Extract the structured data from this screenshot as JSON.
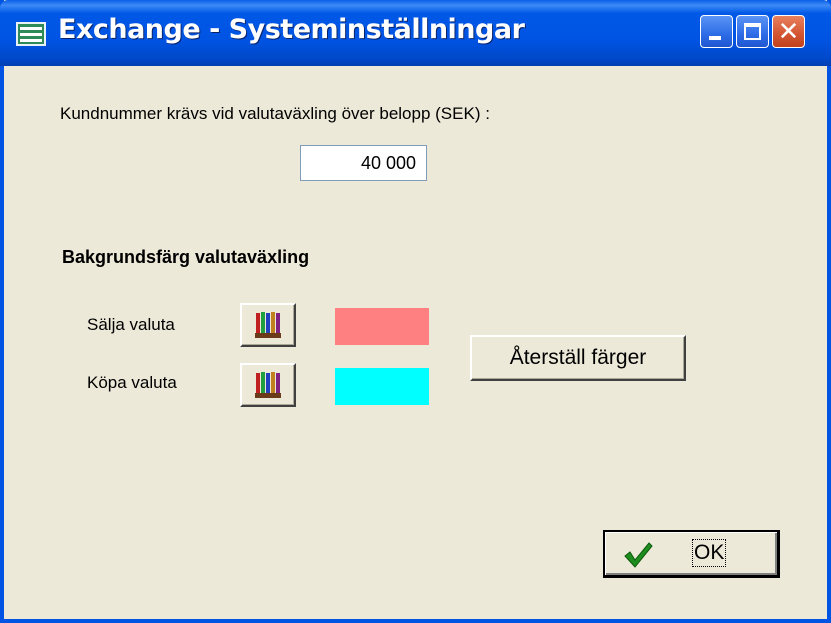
{
  "window": {
    "title": "Exchange - Systeminställningar",
    "controls": {
      "minimize": "minimize",
      "maximize": "maximize",
      "close": "close"
    }
  },
  "settings": {
    "threshold_label": "Kundnummer krävs vid valutaväxling över belopp (SEK) :",
    "threshold_value": "40 000"
  },
  "background_colors": {
    "section_title": "Bakgrundsfärg valutaväxling",
    "sell_label": "Sälja valuta",
    "sell_color": "#FF8080",
    "buy_label": "Köpa valuta",
    "buy_color": "#00FFFF",
    "reset_label": "Återställ färger"
  },
  "ok_label": "OK",
  "icons": {
    "app": "app-icon",
    "palette": "color-palette-icon",
    "ok": "checkmark-icon"
  }
}
